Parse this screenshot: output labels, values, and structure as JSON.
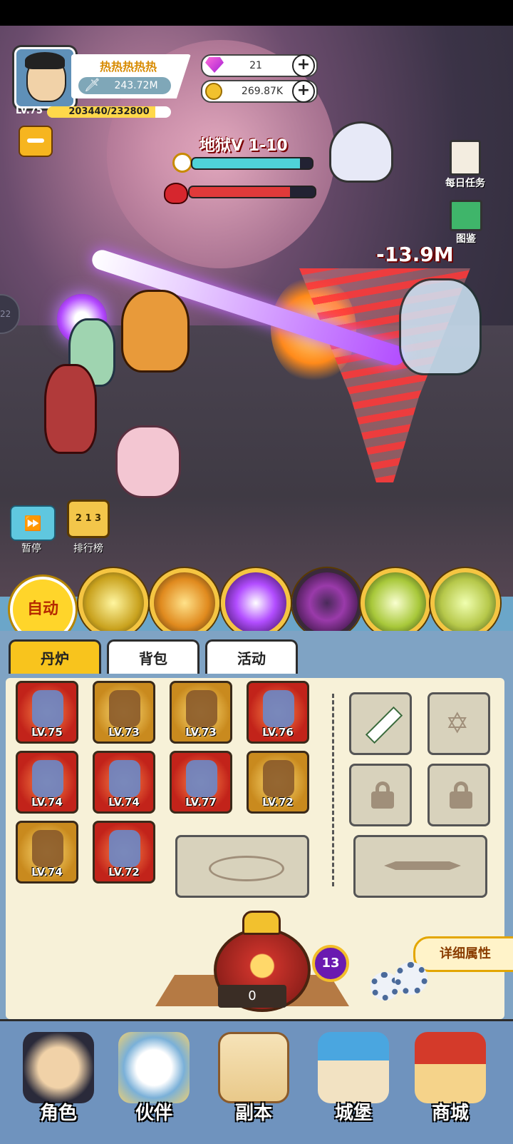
{
  "player": {
    "name": "热热热热热",
    "power": "243.72M",
    "level": "LV.75",
    "xp_text": "203440/232800",
    "xp_fraction": 0.874
  },
  "currency": {
    "gems": "21",
    "gold": "269.87K"
  },
  "stage": {
    "title": "地狱V 1-10",
    "timer_fraction": 0.9,
    "boss_hp_fraction": 0.8
  },
  "battle": {
    "damage_text": "-13.9M"
  },
  "side_buttons": {
    "daily_tasks": "每日任务",
    "codex": "图鉴"
  },
  "controls": {
    "pause": "暂停",
    "ranking": "排行榜",
    "ranking_digits": "2 1 3"
  },
  "edge_tag": "22",
  "skills": {
    "auto": "自动",
    "icons": [
      "skill-1-icon",
      "skill-2-icon",
      "skill-3-icon",
      "skill-4-icon",
      "skill-5-icon",
      "skill-6-icon"
    ]
  },
  "tabs": [
    "丹炉",
    "背包",
    "活动"
  ],
  "equipment": [
    {
      "level": "LV.75",
      "color": "red",
      "icon": "rifle-icon"
    },
    {
      "level": "LV.73",
      "color": "gold",
      "icon": "helmet-icon"
    },
    {
      "level": "LV.73",
      "color": "gold",
      "icon": "armor-icon"
    },
    {
      "level": "LV.76",
      "color": "red",
      "icon": "orb-icon"
    },
    {
      "level": "LV.74",
      "color": "red",
      "icon": "staff-icon"
    },
    {
      "level": "LV.74",
      "color": "red",
      "icon": "bagua-icon"
    },
    {
      "level": "LV.77",
      "color": "red",
      "icon": "bracer-icon"
    },
    {
      "level": "LV.72",
      "color": "gold",
      "icon": "dragon-orb-icon"
    },
    {
      "level": "LV.74",
      "color": "gold",
      "icon": "belt-icon"
    },
    {
      "level": "LV.72",
      "color": "red",
      "icon": "boots-icon"
    }
  ],
  "detail_button": "详细属性",
  "furnace": {
    "count": "0",
    "badge": "13"
  },
  "nav": [
    "角色",
    "伙伴",
    "副本",
    "城堡",
    "商城"
  ],
  "colors": {
    "accent_yellow": "#f8c41d",
    "panel_blue": "#7fa3c4",
    "panel_cream": "#f7f1d8"
  }
}
